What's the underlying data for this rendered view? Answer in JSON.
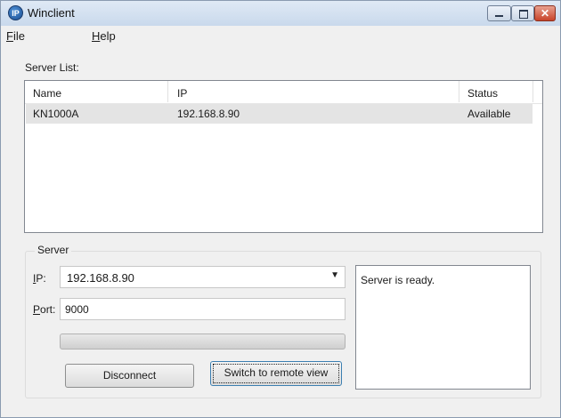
{
  "window": {
    "title": "Winclient",
    "app_icon_text": "IP"
  },
  "menu": [
    {
      "mnemonic": "F",
      "rest": "ile"
    },
    {
      "mnemonic": "H",
      "rest": "elp"
    }
  ],
  "server_list": {
    "label": "Server List:",
    "columns": [
      "Name",
      "IP",
      "Status"
    ],
    "rows": [
      {
        "name": "KN1000A",
        "ip": "192.168.8.90",
        "status": "Available"
      }
    ]
  },
  "server": {
    "group_label": "Server",
    "ip_label_mnemonic": "I",
    "ip_label_rest": "P:",
    "ip_value": "192.168.8.90",
    "port_label_mnemonic": "P",
    "port_label_rest": "ort:",
    "port_value": "9000",
    "disconnect_label": "Disconnect",
    "switch_label": "Switch to remote view",
    "status_message": "Server is ready."
  }
}
